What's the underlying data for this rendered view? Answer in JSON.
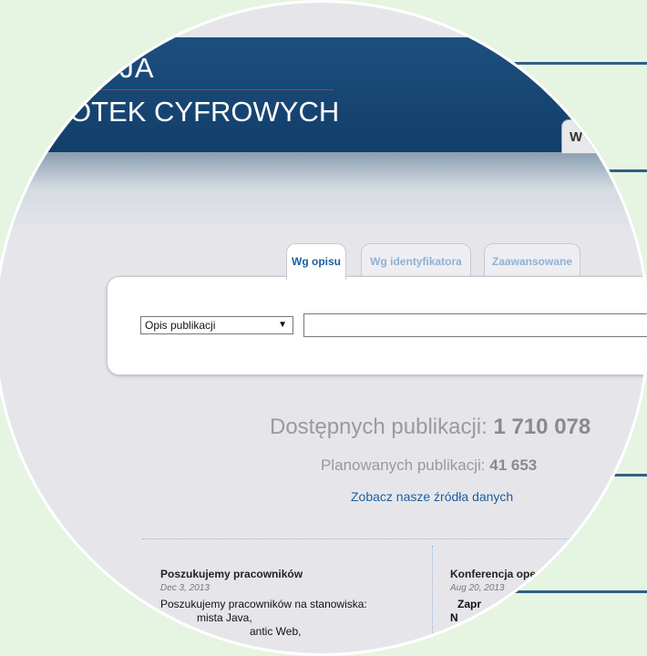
{
  "app": {
    "logo_line1": "CJA",
    "logo_line2": "OTEK CYFROWYCH",
    "header_tab": "W"
  },
  "search": {
    "tabs": [
      {
        "label": "Wg opisu",
        "active": true
      },
      {
        "label": "Wg identyfikatora",
        "active": false
      },
      {
        "label": "Zaawansowane",
        "active": false
      }
    ],
    "field_select": "Opis publikacji",
    "query_value": ""
  },
  "stats": {
    "available_label": "Dostępnych publikacji:",
    "available_value": "1 710 078",
    "planned_label": "Planowanych publikacji:",
    "planned_value": "41 653",
    "sources_link": "Zobacz nasze źródła danych"
  },
  "news": [
    {
      "title": "Poszukujemy pracowników",
      "date": "Dec 3, 2013",
      "lines": [
        "Poszukujemy pracowników na stanowiska:",
        "mista Java,",
        "antic Web,"
      ]
    },
    {
      "title": "Konferencja ope",
      "date": "Aug 20, 2013",
      "lines": [
        "Zapr",
        "N"
      ]
    }
  ],
  "colors": {
    "header": "#1d4f7e",
    "accent": "#1f5ea0",
    "background": "#e6f4e2"
  }
}
